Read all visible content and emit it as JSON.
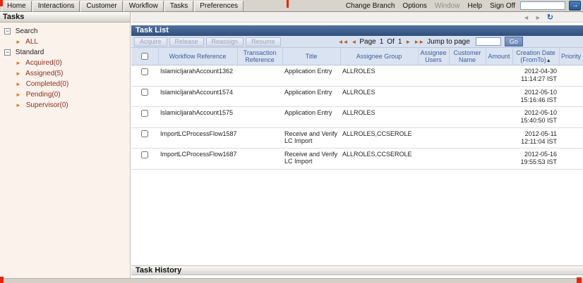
{
  "colors": {
    "tasklist_header_blue": "#3a5a8a",
    "toolbar_bg": "#d8e1f0",
    "table_header_bg": "#dae3f2",
    "table_header_text": "#3b5e99",
    "sidebar_bg": "#fcf2ec",
    "tree_arrow_orange": "#e87617",
    "tree_item_maroon": "#8a2f1e",
    "annotation_red": "#ef2200"
  },
  "icons": {
    "collapse": "−",
    "tree_arrow": "►",
    "back": "◄",
    "forward": "►",
    "refresh": "↻",
    "submit_arrow": "→",
    "first": "◄◄",
    "prev": "◄",
    "next": "►",
    "last": "►►",
    "sort_asc": "▲"
  },
  "menu": {
    "tabs": [
      "Home",
      "Interactions",
      "Customer",
      "Workflow",
      "Tasks",
      "Preferences"
    ],
    "links": [
      "Change Branch",
      "Options",
      "Window",
      "Help",
      "Sign Off"
    ],
    "search_value": ""
  },
  "sidebar": {
    "title": "Tasks",
    "groups": [
      {
        "label": "Search",
        "items": [
          {
            "label": "ALL"
          }
        ]
      },
      {
        "label": "Standard",
        "items": [
          {
            "label": "Acquired(0)"
          },
          {
            "label": "Assigned(5)"
          },
          {
            "label": "Completed(0)"
          },
          {
            "label": "Pending(0)"
          },
          {
            "label": "Supervisor(0)"
          }
        ]
      }
    ]
  },
  "tasklist": {
    "title": "Task List",
    "toolbar": {
      "buttons": [
        "Acquire",
        "Release",
        "Reassign",
        "Resume"
      ]
    },
    "paging": {
      "page_label": "Page",
      "current": "1",
      "of_label": "Of",
      "total": "1",
      "jump_label": "Jump to page",
      "jump_value": "",
      "go_label": "Go"
    },
    "table": {
      "headers": [
        "Workflow Reference",
        "Transaction Reference",
        "Title",
        "Assignee Group",
        "Assignee Users",
        "Customer Name",
        "Amount",
        "Creation Date (FromTo)",
        "Priority"
      ],
      "rows": [
        {
          "workflow_reference": "IslamicIjarahAccount1362",
          "transaction_reference": "",
          "title": "Application Entry",
          "assignee_group": "ALLROLES",
          "assignee_users": "",
          "customer_name": "",
          "amount": "",
          "creation_date": "2012-04-30",
          "creation_time": "11:14:27 IST",
          "priority": ""
        },
        {
          "workflow_reference": "IslamicIjarahAccount1574",
          "transaction_reference": "",
          "title": "Application Entry",
          "assignee_group": "ALLROLES",
          "assignee_users": "",
          "customer_name": "",
          "amount": "",
          "creation_date": "2012-05-10",
          "creation_time": "15:16:46 IST",
          "priority": ""
        },
        {
          "workflow_reference": "IslamicIjarahAccount1575",
          "transaction_reference": "",
          "title": "Application Entry",
          "assignee_group": "ALLROLES",
          "assignee_users": "",
          "customer_name": "",
          "amount": "",
          "creation_date": "2012-05-10",
          "creation_time": "15:40:50 IST",
          "priority": ""
        },
        {
          "workflow_reference": "ImportLCProcessFlow1587",
          "transaction_reference": "",
          "title": "Receive and Verify LC Import",
          "assignee_group": "ALLROLES,CCSEROLE",
          "assignee_users": "",
          "customer_name": "",
          "amount": "",
          "creation_date": "2012-05-11",
          "creation_time": "12:11:04 IST",
          "priority": ""
        },
        {
          "workflow_reference": "ImportLCProcessFlow1687",
          "transaction_reference": "",
          "title": "Receive and Verify LC Import",
          "assignee_group": "ALLROLES,CCSEROLE",
          "assignee_users": "",
          "customer_name": "",
          "amount": "",
          "creation_date": "2012-05-16",
          "creation_time": "19:55:53 IST",
          "priority": ""
        }
      ]
    }
  },
  "task_history": {
    "title": "Task History"
  }
}
